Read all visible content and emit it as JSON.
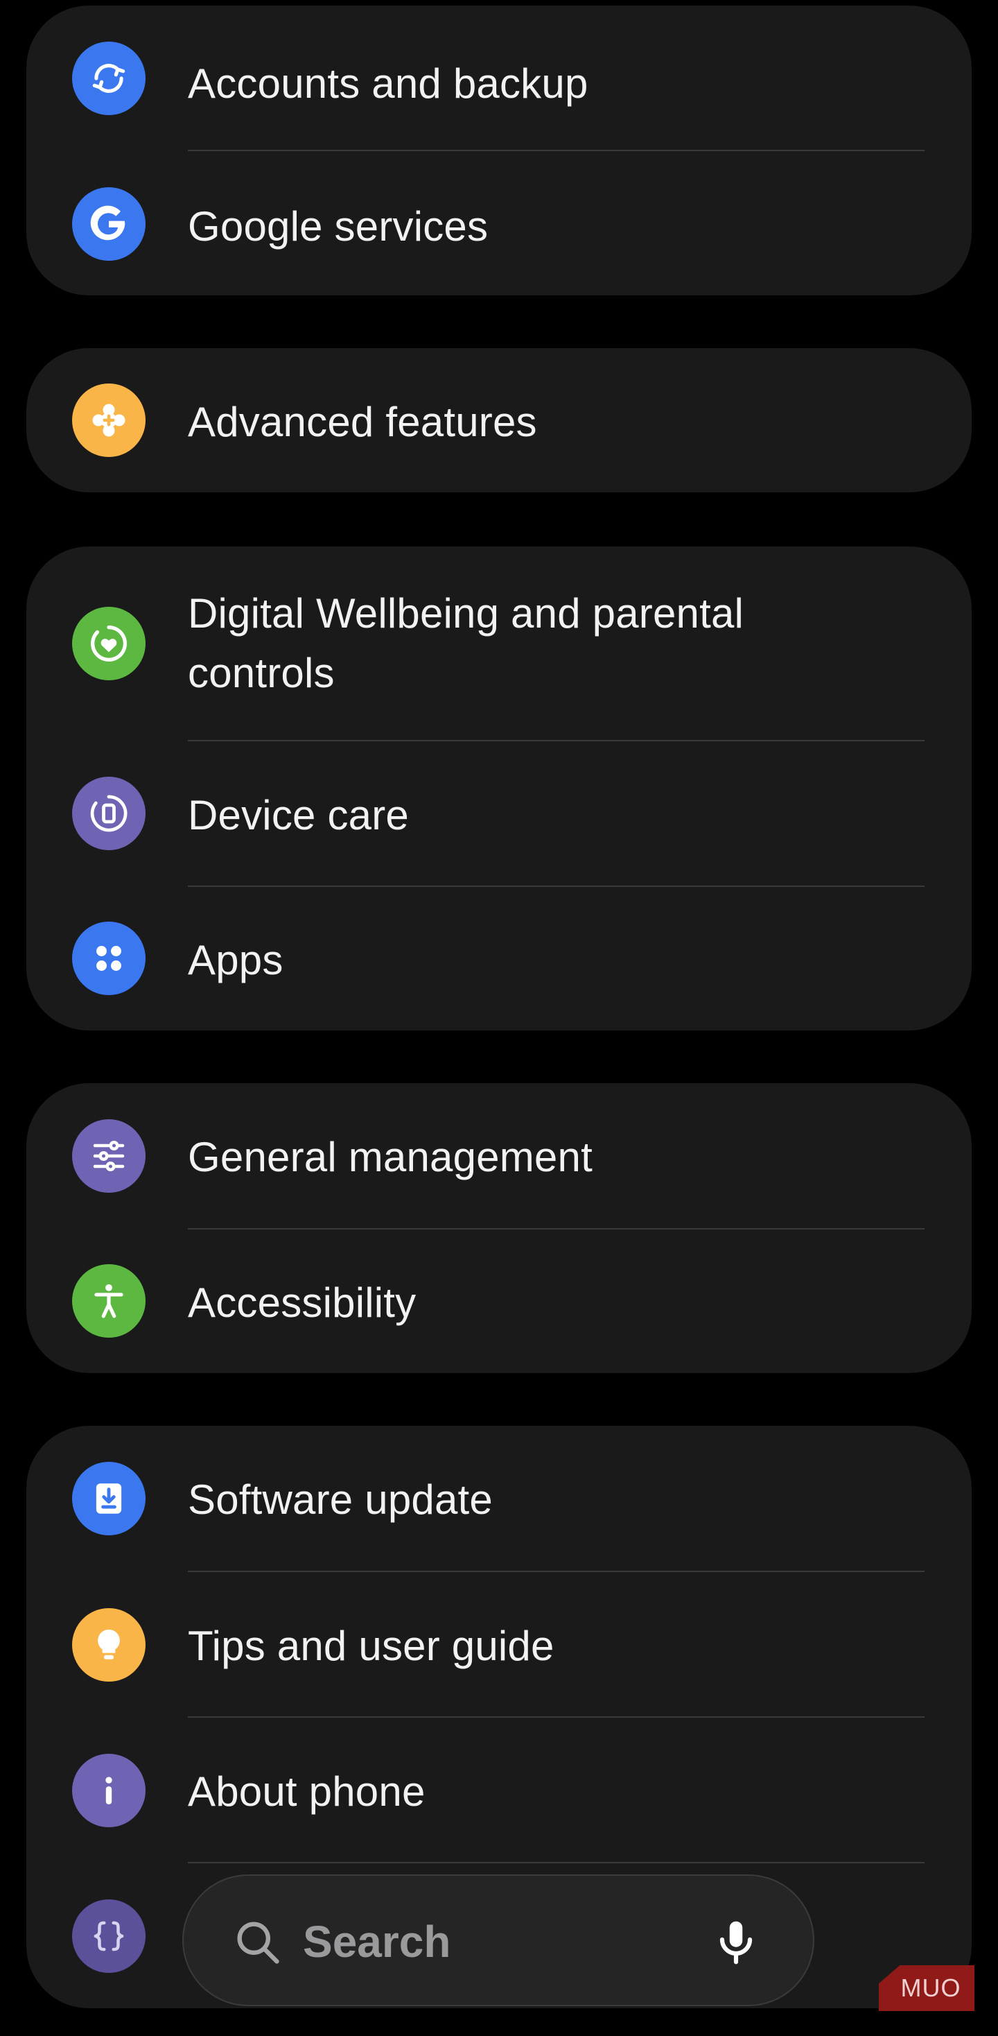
{
  "settings": {
    "accounts_backup": {
      "label": "Accounts and backup",
      "icon": "sync-icon",
      "color": "#3b78f0"
    },
    "google_services": {
      "label": "Google services",
      "icon": "google-g-icon",
      "color": "#3b78f0"
    },
    "advanced_features": {
      "label": "Advanced features",
      "icon": "plus-gear-icon",
      "color": "#f9b547"
    },
    "digital_wellbeing": {
      "label": "Digital Wellbeing and parental controls",
      "icon": "heart-circle-icon",
      "color": "#5cb840"
    },
    "device_care": {
      "label": "Device care",
      "icon": "device-care-icon",
      "color": "#6f63b3"
    },
    "apps": {
      "label": "Apps",
      "icon": "apps-grid-icon",
      "color": "#3b78f0"
    },
    "general_management": {
      "label": "General management",
      "icon": "sliders-icon",
      "color": "#6f63b3"
    },
    "accessibility": {
      "label": "Accessibility",
      "icon": "accessibility-person-icon",
      "color": "#5cb840"
    },
    "software_update": {
      "label": "Software update",
      "icon": "download-icon",
      "color": "#3b78f0"
    },
    "tips_guide": {
      "label": "Tips and user guide",
      "icon": "lightbulb-icon",
      "color": "#f9b547"
    },
    "about_phone": {
      "label": "About phone",
      "icon": "info-icon",
      "color": "#6f63b3"
    },
    "developer_options": {
      "icon": "braces-icon",
      "color": "#5a519a"
    }
  },
  "search": {
    "placeholder": "Search",
    "icon": "search-icon",
    "voice_icon": "microphone-icon"
  },
  "watermark": {
    "text": "MUO"
  }
}
